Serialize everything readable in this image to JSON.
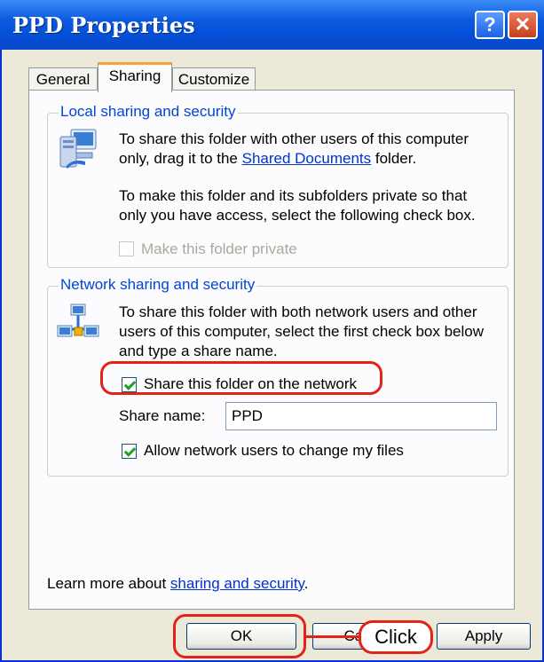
{
  "window": {
    "title": "PPD Properties",
    "help_label": "?",
    "close_label": "✕"
  },
  "tabs": [
    {
      "label": "General",
      "active": false
    },
    {
      "label": "Sharing",
      "active": true
    },
    {
      "label": "Customize",
      "active": false
    }
  ],
  "local": {
    "legend": "Local sharing and security",
    "icon": "shared-computer-icon",
    "p1_line1": "To share this folder with other users of this computer",
    "p1_before": "only, drag it to the ",
    "p1_link": "Shared Documents",
    "p1_after": " folder.",
    "p2_line1": "To make this folder and its subfolders private so that",
    "p2_line2": "only you have access, select the following check box.",
    "private_checkbox": {
      "label": "Make this folder private",
      "checked": false,
      "disabled": true
    }
  },
  "network": {
    "legend": "Network sharing and security",
    "icon": "network-computers-icon",
    "p_line1": "To share this folder with both network users and other",
    "p_line2": "users of this computer, select the first check box below",
    "p_line3": "and type a share name.",
    "share_checkbox": {
      "label": "Share this folder on the network",
      "checked": true
    },
    "share_name_label": "Share name:",
    "share_name_value": "PPD",
    "allow_checkbox": {
      "label": "Allow network users to change my files",
      "checked": true
    }
  },
  "learn_more": {
    "before": "Learn more about ",
    "link": "sharing and security",
    "after": "."
  },
  "buttons": {
    "ok": "OK",
    "cancel": "Cancel",
    "apply": "Apply"
  },
  "annotation": {
    "callout_label": "Click",
    "color": "#e2231a"
  },
  "colors": {
    "titlebar": "#0a5ae0",
    "accent_tab": "#ff9e36",
    "legend": "#0046d5",
    "link": "#0033cc"
  }
}
